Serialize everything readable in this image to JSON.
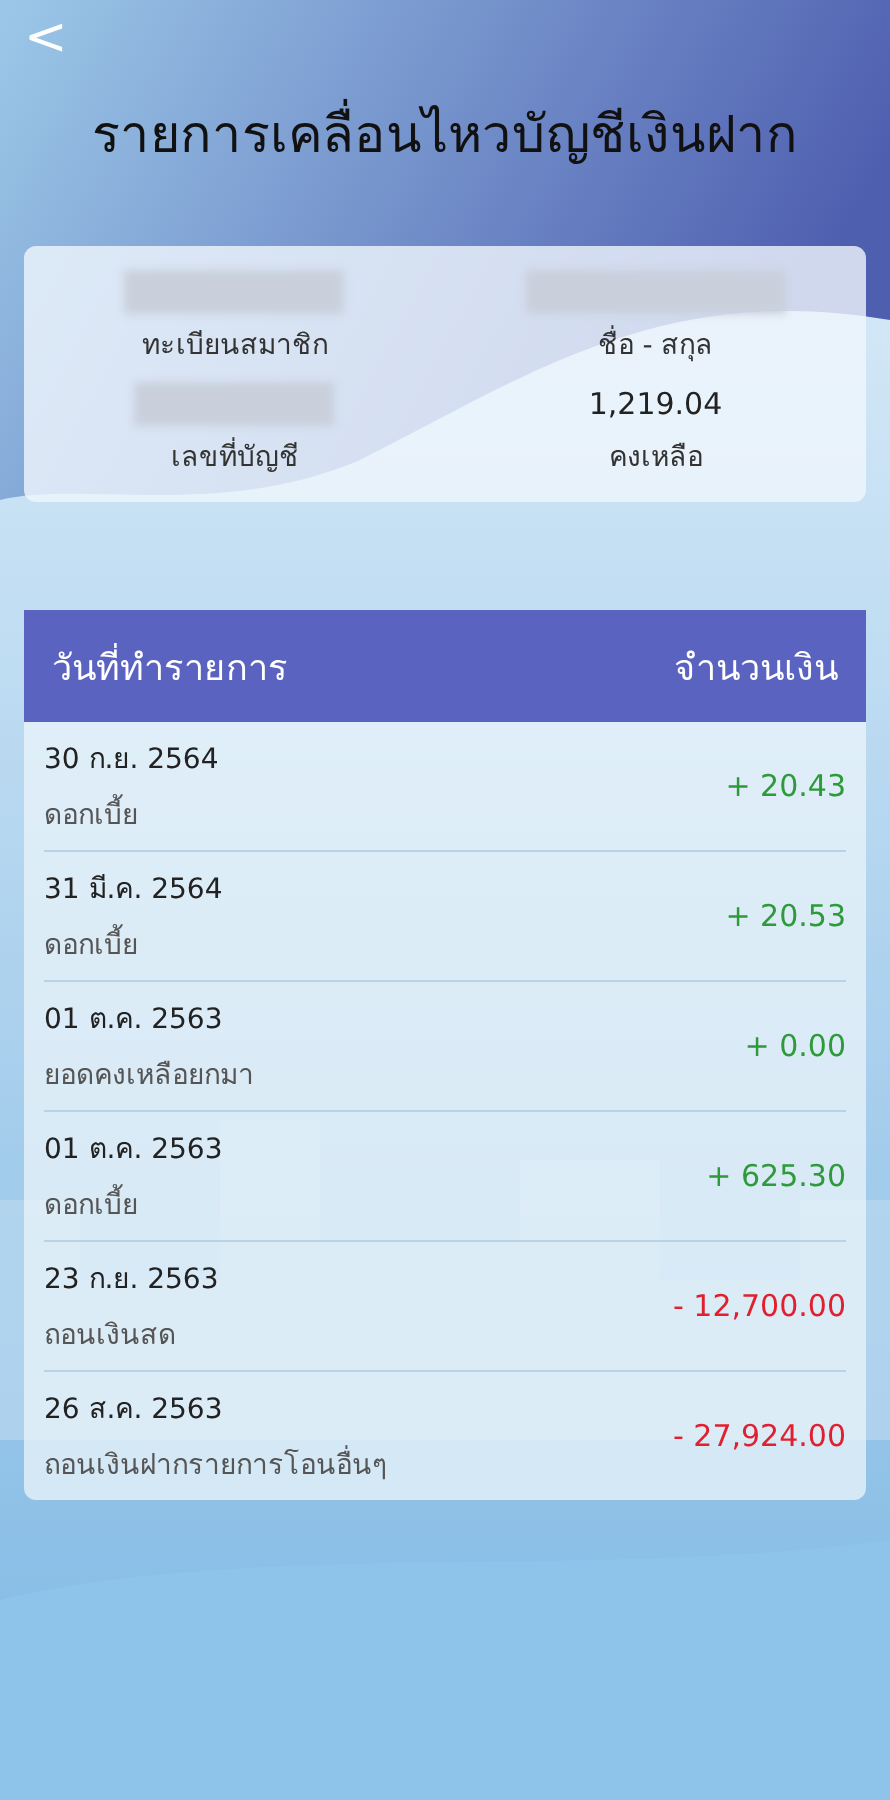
{
  "header": {
    "back": "<",
    "title": "รายการเคลื่อนไหวบัญชีเงินฝาก"
  },
  "member": {
    "rows": [
      {
        "cells": [
          {
            "label": "ทะเบียนสมาชิก",
            "redacted": true
          },
          {
            "label": "ชื่อ - สกุล",
            "redacted": true
          }
        ]
      },
      {
        "cells": [
          {
            "label": "เลขที่บัญชี",
            "redacted": true
          },
          {
            "value": "1,219.04",
            "label": "คงเหลือ"
          }
        ]
      }
    ]
  },
  "table": {
    "columns": [
      "วันที่ทำรายการ",
      "จำนวนเงิน"
    ],
    "rows": [
      {
        "date": "30 ก.ย. 2564",
        "description": "ดอกเบี้ย",
        "amount": "+ 20.43",
        "kind": "credit"
      },
      {
        "date": "31 มี.ค. 2564",
        "description": "ดอกเบี้ย",
        "amount": "+ 20.53",
        "kind": "credit"
      },
      {
        "date": "01 ต.ค. 2563",
        "description": "ยอดคงเหลือยกมา",
        "amount": "+ 0.00",
        "kind": "credit"
      },
      {
        "date": "01 ต.ค. 2563",
        "description": "ดอกเบี้ย",
        "amount": "+ 625.30",
        "kind": "credit"
      },
      {
        "date": "23 ก.ย. 2563",
        "description": "ถอนเงินสด",
        "amount": "- 12,700.00",
        "kind": "debit"
      },
      {
        "date": "26 ส.ค. 2563",
        "description": "ถอนเงินฝากรายการโอนอื่นๆ",
        "amount": "- 27,924.00",
        "kind": "debit"
      }
    ]
  }
}
